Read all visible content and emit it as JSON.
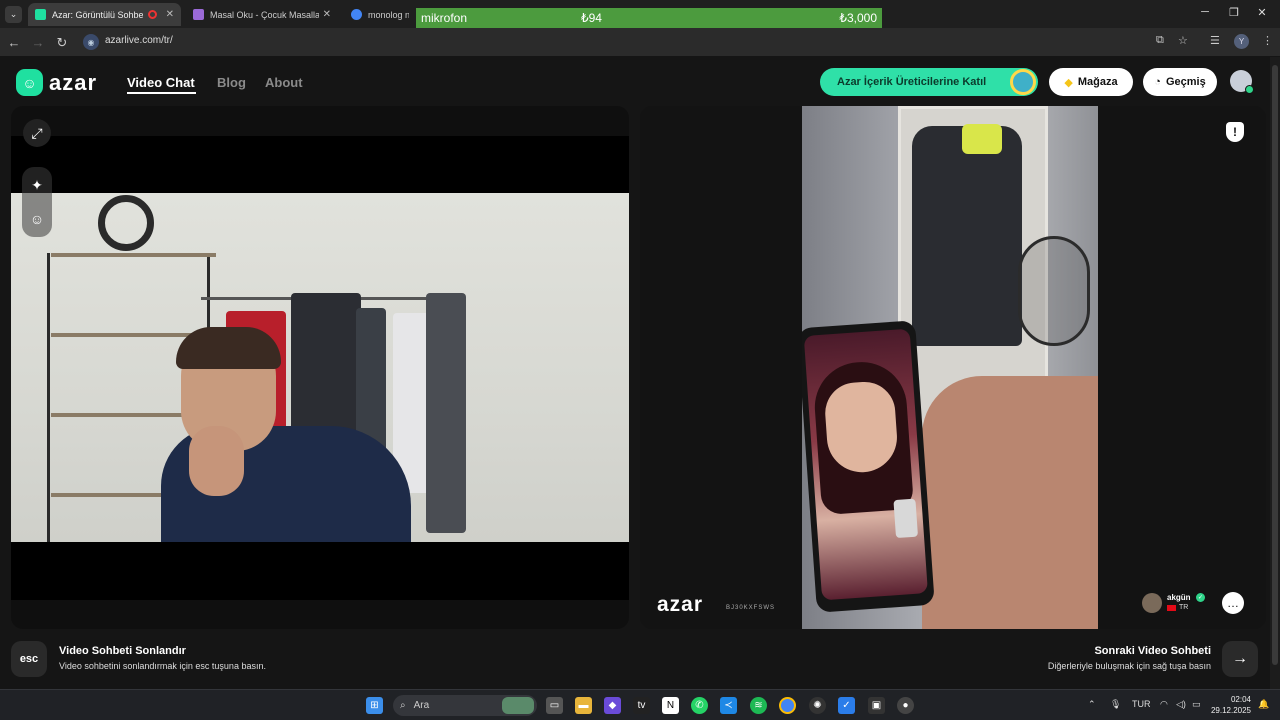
{
  "browser": {
    "tabs": [
      {
        "title": "Azar: Görüntülü Sohbet & V",
        "active": true,
        "favicon_color": "#1fe0a0"
      },
      {
        "title": "Masal Oku - Çocuk Masalları - M",
        "active": false,
        "favicon_color": "#9b6ad8"
      },
      {
        "title": "monolog ne d",
        "active": false,
        "favicon_color": "#4285f4"
      }
    ],
    "url": "azarlive.com/tr/",
    "profile_initial": "Y",
    "overlay": {
      "label": "mikrofon",
      "mid_value": "₺94",
      "right_value": "₺3,000",
      "color": "#4c9b3e"
    }
  },
  "site": {
    "logo_text": "azar",
    "nav": [
      {
        "label": "Video Chat",
        "active": true
      },
      {
        "label": "Blog",
        "active": false
      },
      {
        "label": "About",
        "active": false
      }
    ],
    "creator_button": "Azar İçerik Üreticilerine Katıl",
    "store_button": "Mağaza",
    "history_button": "Geçmiş",
    "accent_color": "#2fe0a8"
  },
  "remote": {
    "logo_text": "azar",
    "room_id": "BJ30KXFSWS",
    "peer_name": "akgün",
    "peer_country": "TR"
  },
  "controls": {
    "esc_key": "esc",
    "end_title": "Video Sohbeti Sonlandır",
    "end_desc": "Video sohbetini sonlandırmak için esc tuşuna basın.",
    "next_title": "Sonraki Video Sohbeti",
    "next_desc": "Diğerleriyle buluşmak için sağ tuşa basın"
  },
  "taskbar": {
    "search_placeholder": "Ara",
    "language": "TUR",
    "time": "02:04",
    "date": "29.12.2025"
  }
}
